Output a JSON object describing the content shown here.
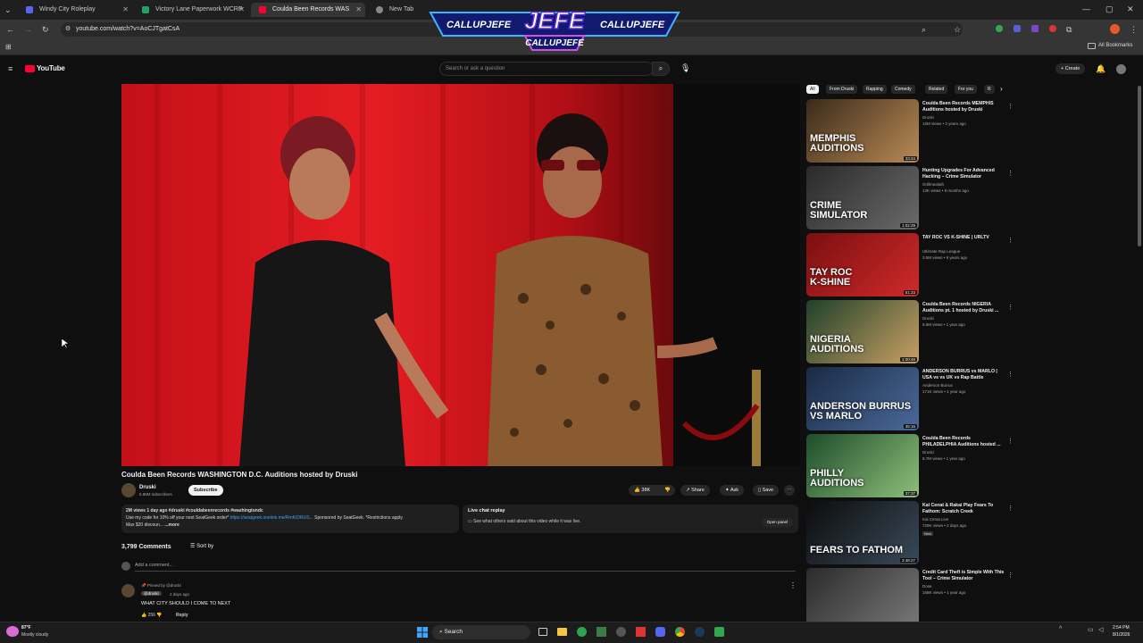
{
  "tabs": [
    {
      "label": "Windy City Roleplay",
      "color": "#5865f2"
    },
    {
      "label": "Victory Lane Paperwork WCRP",
      "color": "#21a366"
    },
    {
      "label": "Coulda Been Records WAS",
      "color": "#ff0033"
    },
    {
      "label": "New Tab",
      "color": "#888888"
    }
  ],
  "address": {
    "url": "youtube.com/watch?v=AoCJTgatCsA"
  },
  "bookmarks": {
    "all_label": "All Bookmarks"
  },
  "overlay": {
    "name": "JEFE",
    "left": "CALLUPJEFE",
    "right": "CALLUPJEFE",
    "bottom": "CALLUPJEFE"
  },
  "yt": {
    "logo": "YouTube",
    "search_placeholder": "Search or ask a question",
    "create": "Create",
    "video": {
      "title": "Coulda Been Records WASHINGTON D.C. Auditions hosted by Druski",
      "channel": "Druski",
      "subs": "5.88M subscribers",
      "subscribe": "Subscribe",
      "likes": "38K",
      "share": "Share",
      "ask": "Ask",
      "save": "Save"
    },
    "desc": {
      "meta": "2M views  1 day ago  #druski #couldabeenrecords #washingtondc",
      "line1": "Use my code for 10% off your next SeatGeek order*",
      "link": "https://seatgeek.onelink.me/RmK/DRUS...",
      "line1b": "Sponsored by SeatGeek. *Restrictions apply.",
      "line2": "Max $20 discoun...",
      "more": "...more"
    },
    "live": {
      "title": "Live chat replay",
      "sub": "See what others said about this video while it was live.",
      "btn": "Open panel"
    },
    "comments": {
      "count": "3,799 Comments",
      "sort": "Sort by",
      "add": "Add a comment...",
      "pinned": "Pinned by @druski",
      "author": "@druski",
      "time": "2 days ago",
      "text": "WHAT CITY SHOULD I COME TO NEXT",
      "likes": "256",
      "reply": "Reply"
    },
    "chips": [
      "All",
      "From Druski",
      "Rapping",
      "Comedy",
      "Related",
      "For you",
      "R"
    ],
    "recs": [
      {
        "title": "Coulda Been Records MEMPHIS Auditions hosted by Druski",
        "channel": "Druski",
        "meta": "15M views • 2 years ago",
        "dur": "33:34",
        "t1": "MEMPHIS",
        "t2": "AUDITIONS",
        "c1": "#3b2a1a",
        "c2": "#b88a55"
      },
      {
        "title": "Hunting Upgrades For Advanced Hacking – Crime Simulator",
        "channel": "Grillmeaitah",
        "meta": "13K views • 9 months ago",
        "dur": "1:02:29",
        "t1": "CRIME",
        "t2": "SIMULATOR",
        "c1": "#2a2a2a",
        "c2": "#6a6a6a"
      },
      {
        "title": "TAY ROC VS K-SHINE | URLTV",
        "channel": "Ultimate Rap League",
        "meta": "3.5M views • 8 years ago",
        "dur": "51:33",
        "t1": "TAY ROC",
        "t2": "K-SHINE",
        "c1": "#7a0f0f",
        "c2": "#d02a2a"
      },
      {
        "title": "Coulda Been Records NIGERIA Auditions pt. 1 hosted by Druski ...",
        "channel": "Druski",
        "meta": "8.5M views • 1 year ago",
        "dur": "1:00:46",
        "t1": "NIGERIA",
        "t2": "AUDITIONS",
        "c1": "#20402a",
        "c2": "#c9a064"
      },
      {
        "title": "ANDERSON BURRUS vs MARLO | USA vs vs UK vs Rap Battle",
        "channel": "Anderson Burrus",
        "meta": "171K views • 1 year ago",
        "dur": "35:16",
        "t1": "ANDERSON BURRUS",
        "t2": "VS MARLO",
        "c1": "#1a2a44",
        "c2": "#4a6a9a"
      },
      {
        "title": "Coulda Been Records PHILADELPHIA Auditions hosted ...",
        "channel": "Druski",
        "meta": "8.7M views • 1 year ago",
        "dur": "37:37",
        "t1": "PHILLY",
        "t2": "AUDITIONS",
        "c1": "#1d4d2a",
        "c2": "#8fbf7a"
      },
      {
        "title": "Kai Cenat & Rakai Play Fears To Fathom: Scratch Creek",
        "channel": "Kai Cenat Live",
        "meta": "729K views • 2 days ago",
        "dur": "3:48:27",
        "badge": "New",
        "t1": "FEARS TO FATHOM",
        "t2": "",
        "c1": "#0c0c0c",
        "c2": "#3a4a5a"
      },
      {
        "title": "Credit Card Theft is Simple With This Tool – Crime Simulator",
        "channel": "Dose",
        "meta": "168K views • 1 year ago",
        "dur": "",
        "t1": "",
        "t2": "",
        "c1": "#2b2b2b",
        "c2": "#7a7a7a"
      }
    ]
  },
  "taskbar": {
    "temp": "87°F",
    "weather": "Mostly cloudy",
    "search": "Search",
    "time": "2:54 PM",
    "date": "8/1/2026"
  }
}
